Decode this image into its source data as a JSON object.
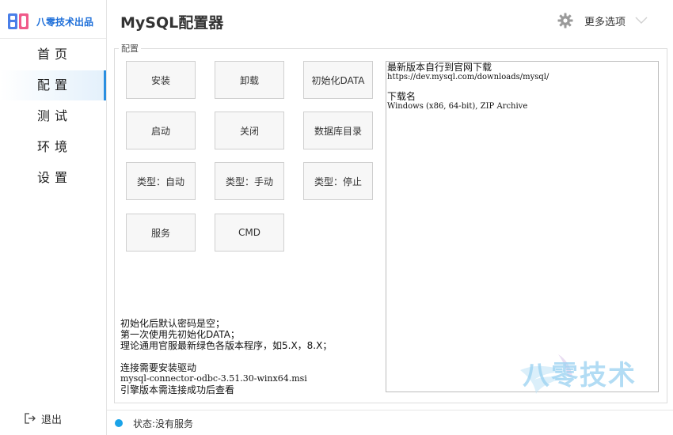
{
  "brand": {
    "name": "八零技术出品",
    "logo_text": "80"
  },
  "nav": [
    {
      "id": "home",
      "label": "首页",
      "active": false
    },
    {
      "id": "config",
      "label": "配置",
      "active": true
    },
    {
      "id": "test",
      "label": "测试",
      "active": false
    },
    {
      "id": "env",
      "label": "环境",
      "active": false
    },
    {
      "id": "settings",
      "label": "设置",
      "active": false
    }
  ],
  "logout_label": "退出",
  "header": {
    "title": "MySQL配置器",
    "more_options": "更多选项"
  },
  "group": {
    "title": "配置",
    "buttons": [
      {
        "id": "install",
        "label": "安装"
      },
      {
        "id": "uninstall",
        "label": "卸载"
      },
      {
        "id": "init-data",
        "label": "初始化DATA"
      },
      {
        "id": "start",
        "label": "启动"
      },
      {
        "id": "stop",
        "label": "关闭"
      },
      {
        "id": "data-dir",
        "label": "数据库目录"
      },
      {
        "id": "type-auto",
        "label": "类型：自动"
      },
      {
        "id": "type-manual",
        "label": "类型：手动"
      },
      {
        "id": "type-disabled",
        "label": "类型：停止"
      },
      {
        "id": "service",
        "label": "服务"
      },
      {
        "id": "cmd",
        "label": "CMD"
      }
    ]
  },
  "info": {
    "line1": "最新版本自行到官网下载",
    "line2": "https://dev.mysql.com/downloads/mysql/",
    "line3": "下载名",
    "line4": "Windows (x86, 64-bit), ZIP Archive"
  },
  "notes": {
    "line1": "初始化后默认密码是空；",
    "line2": "第一次使用先初始化DATA；",
    "line3": "理论通用官服最新绿色各版本程序，如5.X，8.X；",
    "line4": "连接需要安装驱动",
    "line5": "mysql-connector-odbc-3.51.30-winx64.msi",
    "line6": "引擎版本需连接成功后查看"
  },
  "watermark": "八零技术",
  "status": {
    "text": "状态:没有服务",
    "color": "#1aa3e8"
  },
  "colors": {
    "accent": "#2b8fe0",
    "brand": "#1e6fd9"
  }
}
